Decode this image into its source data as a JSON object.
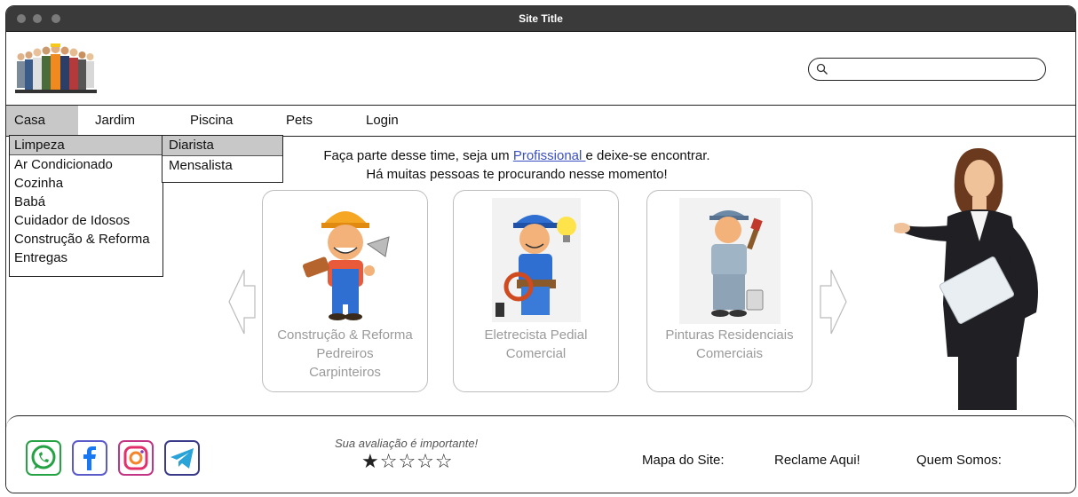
{
  "window": {
    "title": "Site Title"
  },
  "nav": {
    "items": [
      {
        "label": "Casa"
      },
      {
        "label": "Jardim"
      },
      {
        "label": "Piscina"
      },
      {
        "label": "Pets"
      },
      {
        "label": "Login"
      }
    ]
  },
  "dropdown": {
    "items": [
      "Limpeza",
      "Ar Condicionado",
      "Cozinha",
      "Babá",
      "Cuidador de Idosos",
      "Construção & Reforma",
      "Entregas"
    ],
    "submenu": [
      "Diarista",
      "Mensalista"
    ]
  },
  "promo": {
    "line1_before": "Faça parte desse time, seja um ",
    "link": "Profissional ",
    "line1_after": "e deixe-se encontrar.",
    "line2": "Há muitas pessoas te procurando nesse momento!"
  },
  "cards": [
    {
      "line1": "Construção & Reforma",
      "line2": "Pedreiros",
      "line3": "Carpinteiros"
    },
    {
      "line1": "Eletrecista Pedial",
      "line2": "Comercial"
    },
    {
      "line1": "Pinturas Residenciais",
      "line2": "Comerciais"
    }
  ],
  "footer": {
    "rating_label": "Sua avaliação é importante!",
    "rating_stars": "★☆☆☆☆",
    "rating_value": 1,
    "rating_max": 5,
    "links": [
      "Mapa do Site:",
      "Reclame Aqui!",
      "Quem Somos:"
    ],
    "social_icons": [
      "whatsapp-icon",
      "facebook-icon",
      "instagram-icon",
      "telegram-icon"
    ]
  },
  "colors": {
    "titlebar": "#3a3a3a",
    "active_menu": "#c8c8c8",
    "link": "#3a4fc4",
    "whatsapp": "#25a244",
    "facebook": "#1877f2",
    "telegram": "#2aa3d8"
  }
}
